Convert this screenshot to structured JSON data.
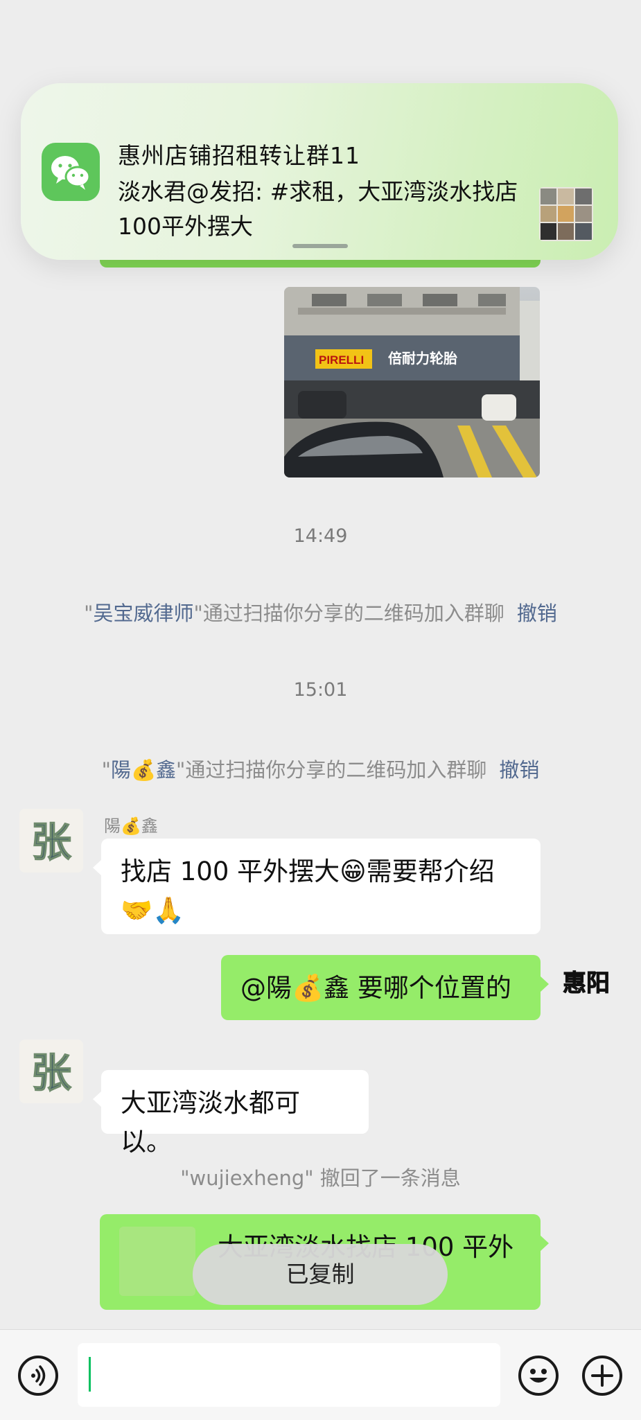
{
  "notification": {
    "title": "惠州店铺招租转让群11",
    "body": "淡水君@发招: #求租，大亚湾淡水找店100平外摆大",
    "app_icon": "wechat-icon"
  },
  "shared_photo": {
    "sign_left": "PIRELLI",
    "sign_right": "倍耐力轮胎"
  },
  "timeline": {
    "time1": "14:49",
    "join1": {
      "quote_open": "\"",
      "name": "吴宝威律师",
      "text": "\"通过扫描你分享的二维码加入群聊",
      "action": "撤销"
    },
    "time2": "15:01",
    "join2": {
      "quote_open": "\"",
      "name": "陽💰鑫",
      "text": "\"通过扫描你分享的二维码加入群聊",
      "action": "撤销"
    }
  },
  "messages": {
    "m1": {
      "sender": "陽💰鑫",
      "avatar_text": "张",
      "text": "找店 100 平外摆大😁需要帮介绍🤝🙏"
    },
    "m2": {
      "text": "@陽💰鑫 要哪个位置的",
      "avatar_text": "惠阳"
    },
    "m3": {
      "avatar_text": "张",
      "text": "大亚湾淡水都可以。"
    },
    "recall": "\"wujiexheng\" 撤回了一条消息",
    "m4": {
      "text": "大亚湾淡水找店 100 平外"
    }
  },
  "toast": "已复制",
  "bottom_bar": {
    "voice_icon": "voice-icon",
    "emoji_icon": "emoji-icon",
    "plus_icon": "plus-icon"
  },
  "colors": {
    "chat_bg": "#ededed",
    "sent_bubble": "#95ec69",
    "received_bubble": "#ffffff",
    "link_blue": "#52698f",
    "wechat_green": "#07c160"
  }
}
